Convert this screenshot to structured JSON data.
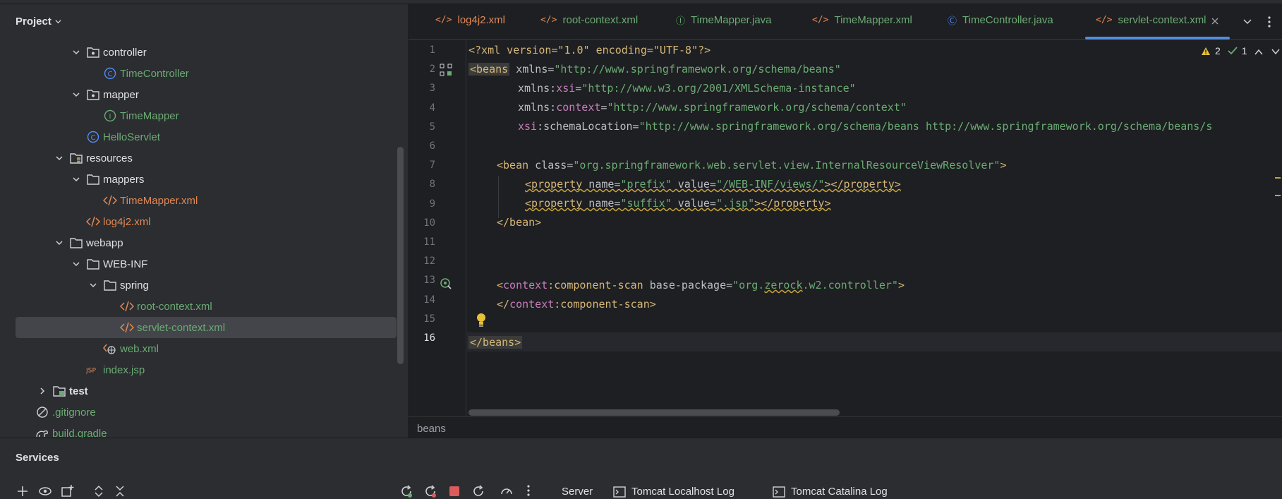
{
  "project_panel": {
    "title": "Project",
    "tree": [
      {
        "label": "controller",
        "kind": "package",
        "color": "plain",
        "expanded": true
      },
      {
        "label": "TimeController",
        "kind": "class",
        "color": "green"
      },
      {
        "label": "mapper",
        "kind": "package",
        "color": "plain",
        "expanded": true
      },
      {
        "label": "TimeMapper",
        "kind": "interface",
        "color": "green"
      },
      {
        "label": "HelloServlet",
        "kind": "class",
        "color": "green"
      },
      {
        "label": "resources",
        "kind": "resources-folder",
        "color": "plain",
        "expanded": true
      },
      {
        "label": "mappers",
        "kind": "folder",
        "color": "plain",
        "expanded": true
      },
      {
        "label": "TimeMapper.xml",
        "kind": "xml",
        "color": "orange"
      },
      {
        "label": "log4j2.xml",
        "kind": "xml",
        "color": "orange"
      },
      {
        "label": "webapp",
        "kind": "folder",
        "color": "plain",
        "expanded": true
      },
      {
        "label": "WEB-INF",
        "kind": "folder",
        "color": "plain",
        "expanded": true
      },
      {
        "label": "spring",
        "kind": "folder",
        "color": "plain",
        "expanded": true
      },
      {
        "label": "root-context.xml",
        "kind": "xml",
        "color": "green"
      },
      {
        "label": "servlet-context.xml",
        "kind": "xml",
        "color": "green",
        "selected": true
      },
      {
        "label": "web.xml",
        "kind": "webxml",
        "color": "green"
      },
      {
        "label": "index.jsp",
        "kind": "jsp",
        "color": "green"
      },
      {
        "label": "test",
        "kind": "test-folder",
        "color": "plain",
        "expanded": false
      },
      {
        "label": ".gitignore",
        "kind": "ignore",
        "color": "green"
      },
      {
        "label": "build.gradle",
        "kind": "gradle",
        "color": "green"
      }
    ]
  },
  "editor": {
    "tabs": [
      {
        "label": "log4j2.xml",
        "icon": "xml-icon",
        "color": "#e08855"
      },
      {
        "label": "root-context.xml",
        "icon": "xml-icon",
        "color": "#6aab73"
      },
      {
        "label": "TimeMapper.java",
        "icon": "interface-icon",
        "color": "#6aab73"
      },
      {
        "label": "TimeMapper.xml",
        "icon": "xml-icon",
        "color": "#6aab73"
      },
      {
        "label": "TimeController.java",
        "icon": "class-icon",
        "color": "#6aab73"
      },
      {
        "label": "servlet-context.xml",
        "icon": "xml-icon",
        "color": "#6aab73",
        "active": true
      }
    ],
    "inspections": {
      "warnings": "2",
      "ok": "1"
    },
    "line_numbers": [
      "1",
      "2",
      "3",
      "4",
      "5",
      "6",
      "7",
      "8",
      "9",
      "10",
      "11",
      "12",
      "13",
      "14",
      "15",
      "16"
    ],
    "current_line": "16",
    "code": {
      "l1": [
        "<?xml version=\"1.0\" encoding=\"UTF-8\"?>"
      ],
      "l2": [
        "<beans",
        " xmlns=",
        "\"http://www.springframework.org/schema/beans\""
      ],
      "l3": [
        "xmlns:",
        "xsi",
        "=",
        "\"http://www.w3.org/2001/XMLSchema-instance\""
      ],
      "l4": [
        "xmlns:",
        "context",
        "=",
        "\"http://www.springframework.org/schema/context\""
      ],
      "l5": [
        "xsi",
        ":schemaLocation=",
        "\"http://www.springframework.org/schema/beans http://www.springframework.org/schema/beans/s"
      ],
      "l7": [
        "<bean",
        " class=",
        "\"org.springframework.web.servlet.view.InternalResourceViewResolver\"",
        ">"
      ],
      "l8": [
        "<property",
        " name=",
        "\"prefix\"",
        " value=",
        "\"/WEB-INF/views/\"",
        "></property>"
      ],
      "l9": [
        "<property",
        " name=",
        "\"suffix\"",
        " value=",
        "\".jsp\"",
        "></property>"
      ],
      "l10": [
        "</bean>"
      ],
      "l13": [
        "<",
        "context",
        ":component-scan",
        " base-package=",
        "\"org.",
        "zerock",
        ".w2.controller\"",
        ">"
      ],
      "l14": [
        "</",
        "context",
        ":component-scan>"
      ],
      "l16": [
        "</beans>"
      ]
    },
    "breadcrumb": "beans"
  },
  "services": {
    "title": "Services",
    "tabs": [
      "Server",
      "Tomcat Localhost Log",
      "Tomcat Catalina Log"
    ]
  }
}
